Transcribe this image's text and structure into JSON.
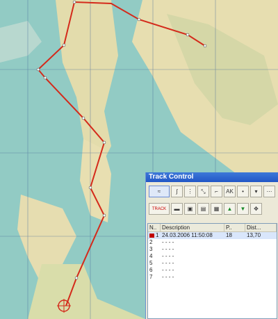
{
  "map": {
    "labels": [
      "Track Control"
    ],
    "route_color": "#d42a1b"
  },
  "track_control": {
    "title": "Track Control",
    "toolbar1": [
      "draw",
      "curve",
      "line",
      "move",
      "split",
      "AK",
      "dot",
      "menu",
      "points"
    ],
    "toolbar2": [
      "TRACK",
      "edit",
      "save",
      "open",
      "properties",
      "up",
      "down",
      "move-all"
    ],
    "columns": [
      "N..",
      "Description",
      "P..",
      "Dist..."
    ],
    "rows": [
      {
        "n": "1",
        "desc": "24.03.2006 11:50:08",
        "p": "18",
        "dist": "13,70",
        "color": "#c00000"
      },
      {
        "n": "2",
        "desc": "- - - -",
        "p": "",
        "dist": ""
      },
      {
        "n": "3",
        "desc": "- - - -",
        "p": "",
        "dist": ""
      },
      {
        "n": "4",
        "desc": "- - - -",
        "p": "",
        "dist": ""
      },
      {
        "n": "5",
        "desc": "- - - -",
        "p": "",
        "dist": ""
      },
      {
        "n": "6",
        "desc": "- - - -",
        "p": "",
        "dist": ""
      },
      {
        "n": "7",
        "desc": "- - - -",
        "p": "",
        "dist": ""
      }
    ]
  }
}
